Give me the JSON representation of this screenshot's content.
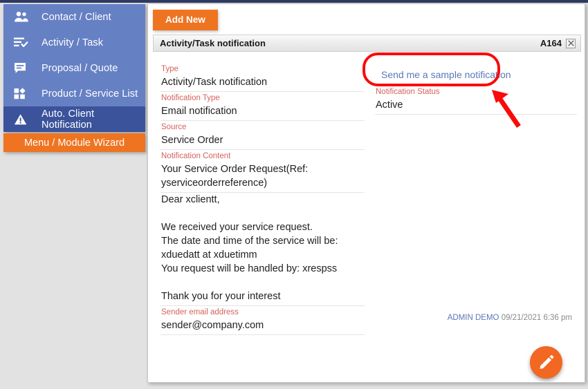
{
  "sidebar": {
    "items": [
      {
        "label": "Contact / Client",
        "icon": "people-icon",
        "active": false
      },
      {
        "label": "Activity / Task",
        "icon": "task-list-check-icon",
        "active": false
      },
      {
        "label": "Proposal / Quote",
        "icon": "speech-bubble-icon",
        "active": false
      },
      {
        "label": "Product / Service List",
        "icon": "grid-blocks-icon",
        "active": false
      },
      {
        "label": "Auto. Client Notification",
        "icon": "warning-triangle-icon",
        "active": true
      }
    ],
    "wizard_button": "Menu / Module Wizard"
  },
  "toolbar": {
    "add_new_label": "Add New"
  },
  "tab": {
    "title": "Activity/Task notification",
    "code": "A164",
    "close_icon": "close-x-icon"
  },
  "form": {
    "left_fields": [
      {
        "label": "Type",
        "value": "Activity/Task notification"
      },
      {
        "label": "Notification Type",
        "value": "Email notification"
      },
      {
        "label": "Source",
        "value": "Service Order"
      },
      {
        "label": "Notification Content",
        "value": "Your Service Order Request(Ref: yserviceorderreference)"
      }
    ],
    "content_body": "Dear xclientt,\n\nWe received your service request.\nThe date and time of the service will be: xduedatt at xduetimm\nYou request will be handled by: xrespss\n\nThank you for your interest",
    "sender_label": "Sender email address",
    "sender_value": "sender@company.com",
    "sample_link": "Send me a sample notification",
    "status_label": "Notification Status",
    "status_value": "Active"
  },
  "footer": {
    "user": "ADMIN DEMO",
    "timestamp": "09/21/2021 6:36 pm"
  },
  "fab": {
    "icon": "pencil-edit-icon"
  },
  "colors": {
    "sidebar_bg": "#6680c4",
    "sidebar_active": "#3a539b",
    "accent_orange": "#ef7421",
    "label_red": "#d4625c",
    "link_blue": "#5b77b8",
    "annotation_red": "#fa0a0a",
    "top_strip": "#2f3a63"
  }
}
